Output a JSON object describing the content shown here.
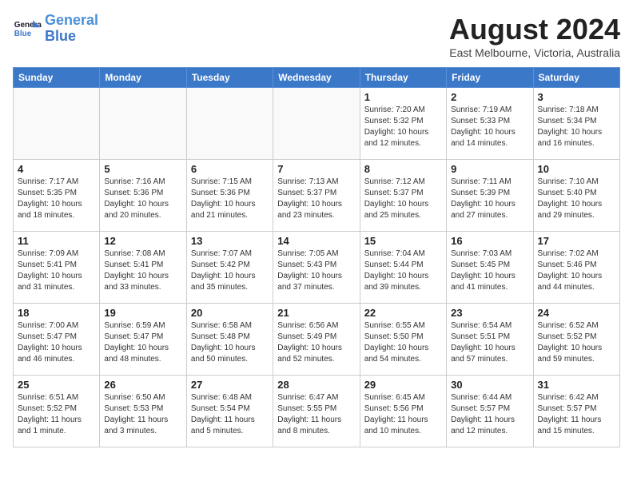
{
  "header": {
    "logo_line1": "General",
    "logo_line2": "Blue",
    "month_year": "August 2024",
    "location": "East Melbourne, Victoria, Australia"
  },
  "days_of_week": [
    "Sunday",
    "Monday",
    "Tuesday",
    "Wednesday",
    "Thursday",
    "Friday",
    "Saturday"
  ],
  "weeks": [
    [
      {
        "day": "",
        "info": ""
      },
      {
        "day": "",
        "info": ""
      },
      {
        "day": "",
        "info": ""
      },
      {
        "day": "",
        "info": ""
      },
      {
        "day": "1",
        "info": "Sunrise: 7:20 AM\nSunset: 5:32 PM\nDaylight: 10 hours\nand 12 minutes."
      },
      {
        "day": "2",
        "info": "Sunrise: 7:19 AM\nSunset: 5:33 PM\nDaylight: 10 hours\nand 14 minutes."
      },
      {
        "day": "3",
        "info": "Sunrise: 7:18 AM\nSunset: 5:34 PM\nDaylight: 10 hours\nand 16 minutes."
      }
    ],
    [
      {
        "day": "4",
        "info": "Sunrise: 7:17 AM\nSunset: 5:35 PM\nDaylight: 10 hours\nand 18 minutes."
      },
      {
        "day": "5",
        "info": "Sunrise: 7:16 AM\nSunset: 5:36 PM\nDaylight: 10 hours\nand 20 minutes."
      },
      {
        "day": "6",
        "info": "Sunrise: 7:15 AM\nSunset: 5:36 PM\nDaylight: 10 hours\nand 21 minutes."
      },
      {
        "day": "7",
        "info": "Sunrise: 7:13 AM\nSunset: 5:37 PM\nDaylight: 10 hours\nand 23 minutes."
      },
      {
        "day": "8",
        "info": "Sunrise: 7:12 AM\nSunset: 5:37 PM\nDaylight: 10 hours\nand 25 minutes."
      },
      {
        "day": "9",
        "info": "Sunrise: 7:11 AM\nSunset: 5:39 PM\nDaylight: 10 hours\nand 27 minutes."
      },
      {
        "day": "10",
        "info": "Sunrise: 7:10 AM\nSunset: 5:40 PM\nDaylight: 10 hours\nand 29 minutes."
      }
    ],
    [
      {
        "day": "11",
        "info": "Sunrise: 7:09 AM\nSunset: 5:41 PM\nDaylight: 10 hours\nand 31 minutes."
      },
      {
        "day": "12",
        "info": "Sunrise: 7:08 AM\nSunset: 5:41 PM\nDaylight: 10 hours\nand 33 minutes."
      },
      {
        "day": "13",
        "info": "Sunrise: 7:07 AM\nSunset: 5:42 PM\nDaylight: 10 hours\nand 35 minutes."
      },
      {
        "day": "14",
        "info": "Sunrise: 7:05 AM\nSunset: 5:43 PM\nDaylight: 10 hours\nand 37 minutes."
      },
      {
        "day": "15",
        "info": "Sunrise: 7:04 AM\nSunset: 5:44 PM\nDaylight: 10 hours\nand 39 minutes."
      },
      {
        "day": "16",
        "info": "Sunrise: 7:03 AM\nSunset: 5:45 PM\nDaylight: 10 hours\nand 41 minutes."
      },
      {
        "day": "17",
        "info": "Sunrise: 7:02 AM\nSunset: 5:46 PM\nDaylight: 10 hours\nand 44 minutes."
      }
    ],
    [
      {
        "day": "18",
        "info": "Sunrise: 7:00 AM\nSunset: 5:47 PM\nDaylight: 10 hours\nand 46 minutes."
      },
      {
        "day": "19",
        "info": "Sunrise: 6:59 AM\nSunset: 5:47 PM\nDaylight: 10 hours\nand 48 minutes."
      },
      {
        "day": "20",
        "info": "Sunrise: 6:58 AM\nSunset: 5:48 PM\nDaylight: 10 hours\nand 50 minutes."
      },
      {
        "day": "21",
        "info": "Sunrise: 6:56 AM\nSunset: 5:49 PM\nDaylight: 10 hours\nand 52 minutes."
      },
      {
        "day": "22",
        "info": "Sunrise: 6:55 AM\nSunset: 5:50 PM\nDaylight: 10 hours\nand 54 minutes."
      },
      {
        "day": "23",
        "info": "Sunrise: 6:54 AM\nSunset: 5:51 PM\nDaylight: 10 hours\nand 57 minutes."
      },
      {
        "day": "24",
        "info": "Sunrise: 6:52 AM\nSunset: 5:52 PM\nDaylight: 10 hours\nand 59 minutes."
      }
    ],
    [
      {
        "day": "25",
        "info": "Sunrise: 6:51 AM\nSunset: 5:52 PM\nDaylight: 11 hours\nand 1 minute."
      },
      {
        "day": "26",
        "info": "Sunrise: 6:50 AM\nSunset: 5:53 PM\nDaylight: 11 hours\nand 3 minutes."
      },
      {
        "day": "27",
        "info": "Sunrise: 6:48 AM\nSunset: 5:54 PM\nDaylight: 11 hours\nand 5 minutes."
      },
      {
        "day": "28",
        "info": "Sunrise: 6:47 AM\nSunset: 5:55 PM\nDaylight: 11 hours\nand 8 minutes."
      },
      {
        "day": "29",
        "info": "Sunrise: 6:45 AM\nSunset: 5:56 PM\nDaylight: 11 hours\nand 10 minutes."
      },
      {
        "day": "30",
        "info": "Sunrise: 6:44 AM\nSunset: 5:57 PM\nDaylight: 11 hours\nand 12 minutes."
      },
      {
        "day": "31",
        "info": "Sunrise: 6:42 AM\nSunset: 5:57 PM\nDaylight: 11 hours\nand 15 minutes."
      }
    ]
  ]
}
